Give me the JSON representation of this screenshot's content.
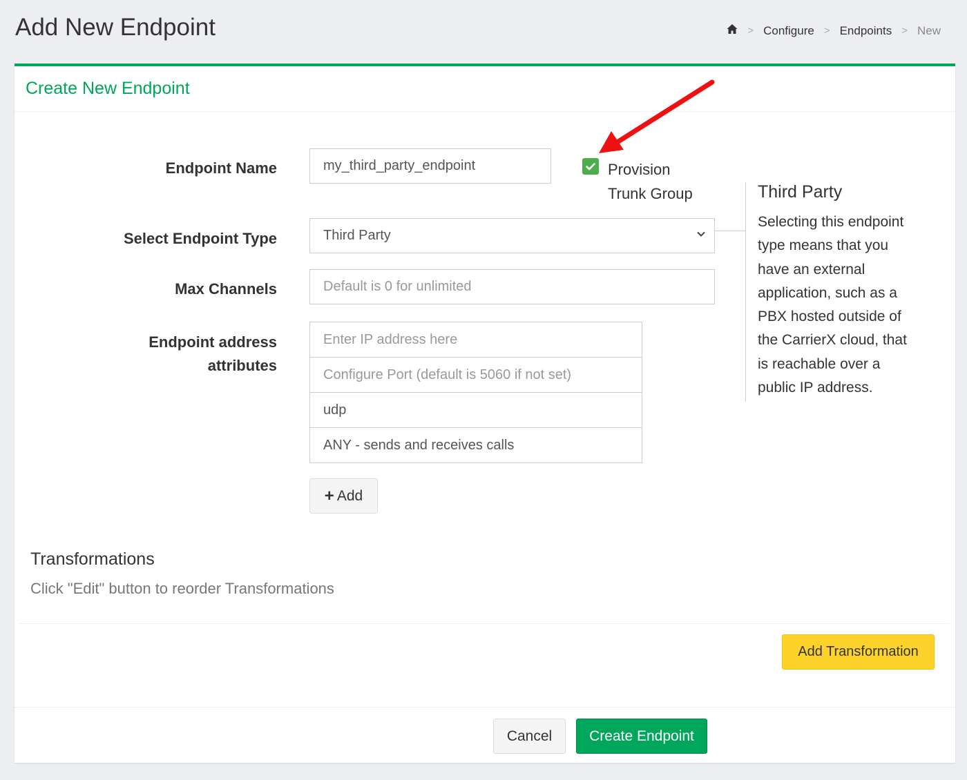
{
  "page": {
    "title": "Add New Endpoint"
  },
  "breadcrumb": {
    "home_icon": "home-icon",
    "items": [
      "Configure",
      "Endpoints",
      "New"
    ],
    "separator": ">"
  },
  "card": {
    "title": "Create New Endpoint",
    "accent_color": "#00a65a"
  },
  "form": {
    "endpoint_name": {
      "label": "Endpoint Name",
      "value": "my_third_party_endpoint"
    },
    "provision_trunk_group": {
      "checked": true,
      "label_line1": "Provision",
      "label_line2": "Trunk Group"
    },
    "endpoint_type": {
      "label": "Select Endpoint Type",
      "value": "Third Party"
    },
    "max_channels": {
      "label": "Max Channels",
      "placeholder": "Default is 0 for unlimited"
    },
    "address_attributes": {
      "label_line1": "Endpoint address",
      "label_line2": "attributes",
      "ip_placeholder": "Enter IP address here",
      "port_placeholder": "Configure Port (default is 5060 if not set)",
      "transport": "udp",
      "direction": "ANY - sends and receives calls",
      "add_button": "Add"
    }
  },
  "help": {
    "title": "Third Party",
    "lines": [
      "Selecting this endpoint",
      "type means that you",
      "have an external",
      "application, such as a",
      "PBX hosted outside of",
      "the CarrierX cloud, that",
      "is reachable over a",
      "public IP address."
    ]
  },
  "transformations": {
    "title": "Transformations",
    "subtitle": "Click \"Edit\" button to reorder Transformations",
    "add_button": "Add Transformation",
    "button_color": "#fdd22b"
  },
  "footer": {
    "cancel": "Cancel",
    "create": "Create Endpoint"
  },
  "annotation": {
    "arrow_color": "#ee1111"
  }
}
